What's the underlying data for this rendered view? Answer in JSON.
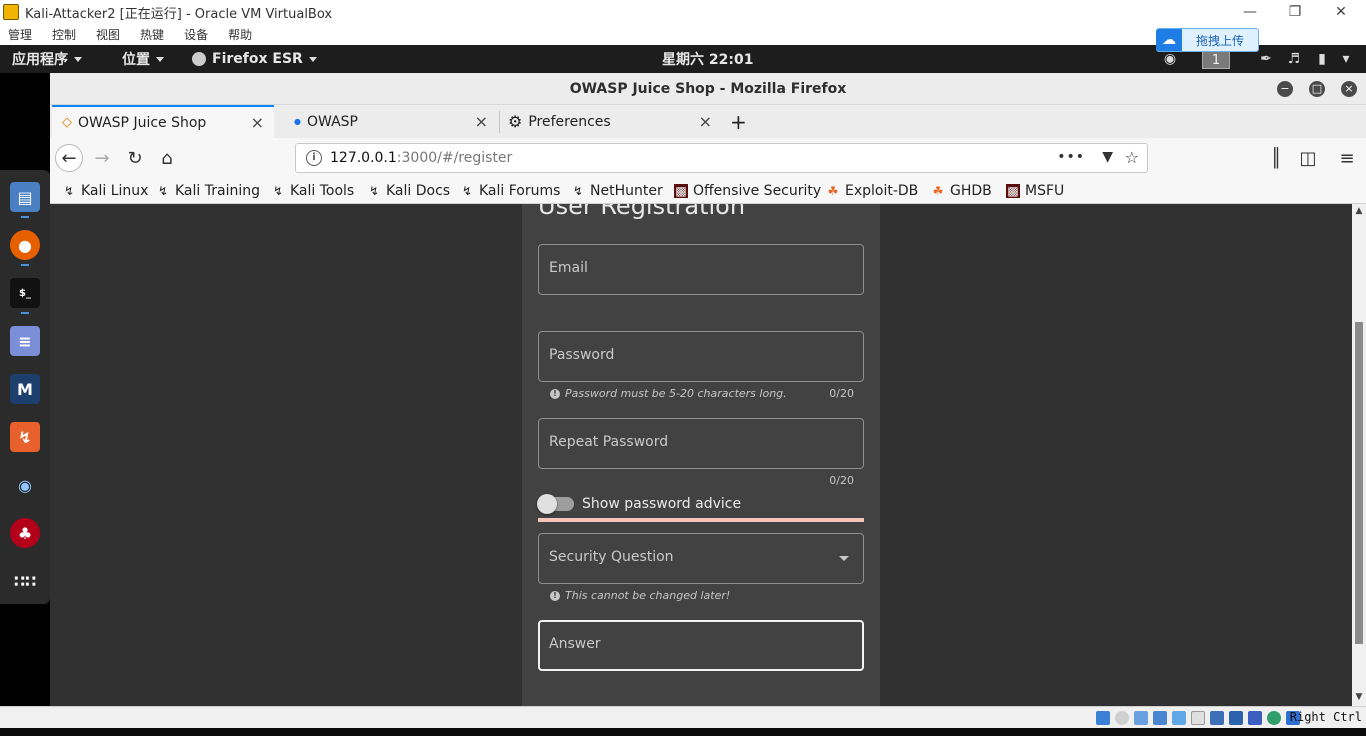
{
  "vbox": {
    "title": "Kali-Attacker2 [正在运行] - Oracle VM VirtualBox",
    "menu": [
      "管理",
      "控制",
      "视图",
      "热键",
      "设备",
      "帮助"
    ],
    "host_key": "Right Ctrl"
  },
  "upload_widget": {
    "label": "拖拽上传"
  },
  "gnome": {
    "apps_label": "应用程序",
    "places_label": "位置",
    "firefox_label": "Firefox ESR",
    "clock": "星期六 22:01",
    "workspace": "1"
  },
  "firefox": {
    "window_title": "OWASP Juice Shop - Mozilla Firefox",
    "tabs": [
      {
        "label": "OWASP Juice Shop",
        "icon": "juice-shop-icon"
      },
      {
        "label": "OWASP",
        "icon": "dot-icon"
      },
      {
        "label": "Preferences",
        "icon": "gear-icon"
      }
    ],
    "url": {
      "host": "127.0.0.1",
      "rest": ":3000/#/register"
    },
    "bookmarks": [
      {
        "label": "Kali Linux",
        "icon": "kali-dragon-icon"
      },
      {
        "label": "Kali Training",
        "icon": "kali-dragon-icon"
      },
      {
        "label": "Kali Tools",
        "icon": "kali-dragon-icon"
      },
      {
        "label": "Kali Docs",
        "icon": "kali-dragon-icon"
      },
      {
        "label": "Kali Forums",
        "icon": "kali-dragon-icon"
      },
      {
        "label": "NetHunter",
        "icon": "kali-dragon-icon"
      },
      {
        "label": "Offensive Security",
        "icon": "offsec-icon"
      },
      {
        "label": "Exploit-DB",
        "icon": "exploitdb-icon"
      },
      {
        "label": "GHDB",
        "icon": "exploitdb-icon"
      },
      {
        "label": "MSFU",
        "icon": "offsec-icon"
      }
    ]
  },
  "form": {
    "title": "User Registration",
    "email_label": "Email",
    "password_label": "Password",
    "password_hint": "Password must be 5-20 characters long.",
    "password_counter": "0/20",
    "repeat_label": "Repeat Password",
    "repeat_counter": "0/20",
    "advice_label": "Show password advice",
    "security_label": "Security Question",
    "security_hint": "This cannot be changed later!",
    "answer_label": "Answer"
  },
  "colors": {
    "page_bg": "#303030",
    "card_bg": "#424242",
    "tab_accent": "#0a84ff",
    "strength_bar": "#f6c4b8"
  }
}
